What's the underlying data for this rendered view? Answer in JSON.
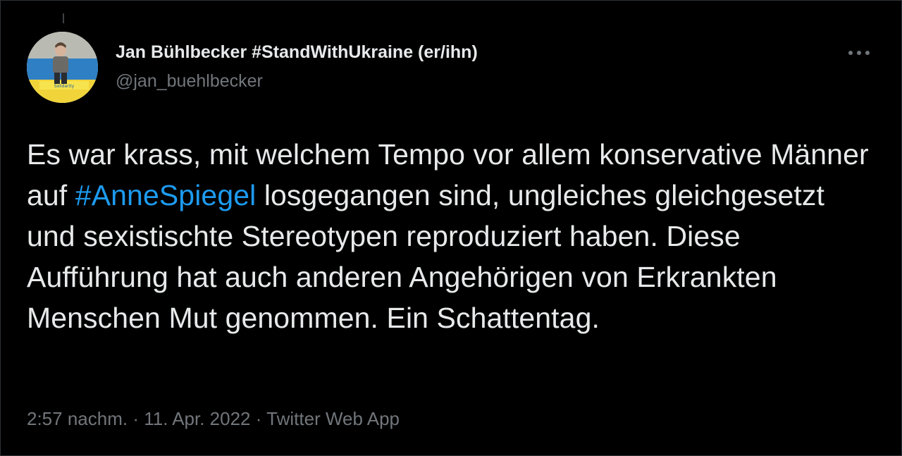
{
  "tweet": {
    "author": {
      "display_name": "Jan Bühlbecker #StandWithUkraine (er/ihn)",
      "handle": "@jan_buehlbecker",
      "avatar_banner_text": "Solidarity"
    },
    "more_icon": "ellipsis-icon",
    "text_before_hashtag": "Es war krass, mit welchem Tempo vor allem konservative Männer auf ",
    "hashtag": "#AnneSpiegel",
    "text_after_hashtag": " losgegangen sind, ungleiches gleichgesetzt und sexistischte Stereotypen reproduziert haben. Diese Aufführung hat auch anderen Angehörigen von Erkrankten Menschen Mut genommen. Ein Schattentag.",
    "time": "2:57 nachm.",
    "separator": " · ",
    "date": "11. Apr. 2022",
    "source": "Twitter Web App",
    "colors": {
      "background": "#000000",
      "text": "#e7e9ea",
      "secondary": "#71767b",
      "link": "#1d9bf0"
    }
  }
}
